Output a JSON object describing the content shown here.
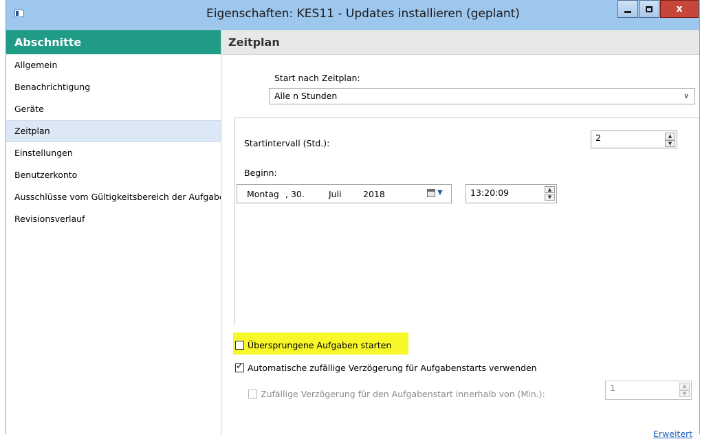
{
  "window": {
    "title": "Eigenschaften: KES11 - Updates installieren (geplant)",
    "close_glyph": "x"
  },
  "sidebar": {
    "header": "Abschnitte",
    "items": [
      {
        "label": "Allgemein"
      },
      {
        "label": "Benachrichtigung"
      },
      {
        "label": "Geräte"
      },
      {
        "label": "Zeitplan",
        "selected": true
      },
      {
        "label": "Einstellungen"
      },
      {
        "label": "Benutzerkonto"
      },
      {
        "label": "Ausschlüsse vom Gültigkeitsbereich der Aufgabe"
      },
      {
        "label": "Revisionsverlauf"
      }
    ]
  },
  "main": {
    "header": "Zeitplan",
    "schedule": {
      "label": "Start nach Zeitplan:",
      "value": "Alle n Stunden"
    },
    "interval": {
      "label": "Startintervall (Std.):",
      "value": "2"
    },
    "begin": {
      "label": "Beginn:",
      "date": {
        "weekday": "Montag",
        "day": ", 30.",
        "month": "Juli",
        "year": "2018"
      },
      "time": "13:20:09"
    },
    "skip_missed": {
      "label": "Übersprungene Aufgaben starten",
      "checked": false,
      "highlight_color": "#f7f72a"
    },
    "auto_delay": {
      "label": "Automatische zufällige Verzögerung für Aufgabenstarts verwenden",
      "checked": true
    },
    "random_delay": {
      "label": "Zufällige Verzögerung für den Aufgabenstart innerhalb von (Min.):",
      "checked": false,
      "enabled": false,
      "value": "1"
    },
    "advanced_link": "Erweitert"
  },
  "colors": {
    "titlebar": "#9ec7ee",
    "sidebar_header": "#1f9b86",
    "selection": "#dce8f5",
    "link": "#1e5ec2"
  }
}
